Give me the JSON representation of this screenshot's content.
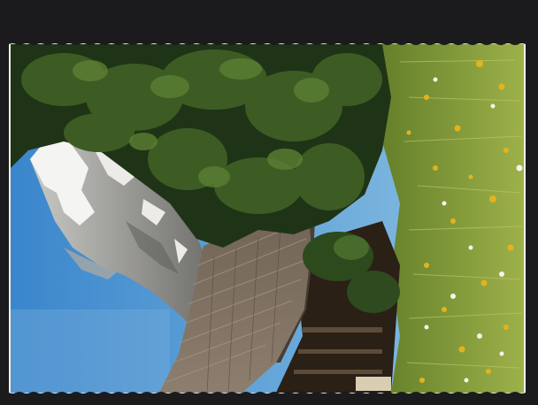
{
  "image": {
    "subject": "",
    "colors": {
      "border": "#1b1b1d",
      "card": "#f2f2ee",
      "sky": "#3f8fd2",
      "sky_light": "#9ccbe6",
      "rock": "#8c8c8a",
      "snow": "#f4f4f2",
      "foliage_dark": "#1f3416",
      "foliage": "#3d5c24",
      "grass": "#8aa03a",
      "roof": "#7a6a5c",
      "flower_yellow": "#e6b21c",
      "flower_white": "#f6f3ea"
    }
  }
}
